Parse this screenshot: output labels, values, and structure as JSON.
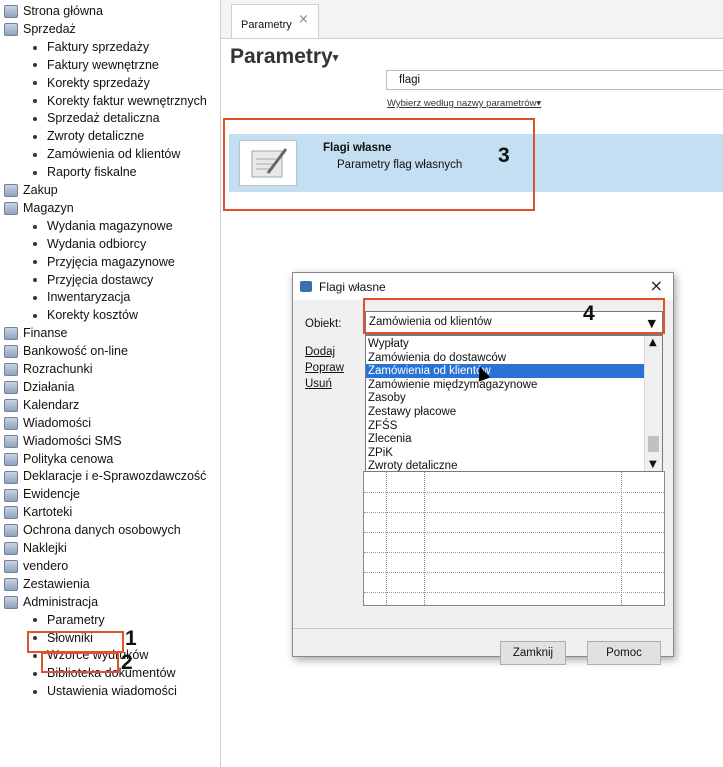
{
  "sidebar": {
    "items": [
      {
        "label": "Strona główna",
        "type": "top"
      },
      {
        "label": "Sprzedaż",
        "type": "top"
      },
      {
        "label": "Faktury sprzedaży",
        "type": "sub"
      },
      {
        "label": "Faktury wewnętrzne",
        "type": "sub"
      },
      {
        "label": "Korekty sprzedaży",
        "type": "sub"
      },
      {
        "label": "Korekty faktur wewnętrznych",
        "type": "sub"
      },
      {
        "label": "Sprzedaż detaliczna",
        "type": "sub"
      },
      {
        "label": "Zwroty detaliczne",
        "type": "sub"
      },
      {
        "label": "Zamówienia od klientów",
        "type": "sub"
      },
      {
        "label": "Raporty fiskalne",
        "type": "sub"
      },
      {
        "label": "Zakup",
        "type": "top"
      },
      {
        "label": "Magazyn",
        "type": "top"
      },
      {
        "label": "Wydania magazynowe",
        "type": "sub"
      },
      {
        "label": "Wydania odbiorcy",
        "type": "sub"
      },
      {
        "label": "Przyjęcia magazynowe",
        "type": "sub"
      },
      {
        "label": "Przyjęcia dostawcy",
        "type": "sub"
      },
      {
        "label": "Inwentaryzacja",
        "type": "sub"
      },
      {
        "label": "Korekty kosztów",
        "type": "sub"
      },
      {
        "label": "Finanse",
        "type": "top"
      },
      {
        "label": "Bankowość on-line",
        "type": "top"
      },
      {
        "label": "Rozrachunki",
        "type": "top"
      },
      {
        "label": "Działania",
        "type": "top"
      },
      {
        "label": "Kalendarz",
        "type": "top"
      },
      {
        "label": "Wiadomości",
        "type": "top"
      },
      {
        "label": "Wiadomości SMS",
        "type": "top"
      },
      {
        "label": "Polityka cenowa",
        "type": "top"
      },
      {
        "label": "Deklaracje i e-Sprawozdawczość",
        "type": "top"
      },
      {
        "label": "Ewidencje",
        "type": "top"
      },
      {
        "label": "Kartoteki",
        "type": "top"
      },
      {
        "label": "Ochrona danych osobowych",
        "type": "top"
      },
      {
        "label": "Naklejki",
        "type": "top"
      },
      {
        "label": "vendero",
        "type": "top"
      },
      {
        "label": "Zestawienia",
        "type": "top"
      },
      {
        "label": "Administracja",
        "type": "top"
      },
      {
        "label": "Parametry",
        "type": "sub"
      },
      {
        "label": "Słowniki",
        "type": "sub"
      },
      {
        "label": "Wzorce wydruków",
        "type": "sub"
      },
      {
        "label": "Biblioteka dokumentów",
        "type": "sub"
      },
      {
        "label": "Ustawienia wiadomości",
        "type": "sub"
      }
    ]
  },
  "tab": {
    "label": "Parametry",
    "close": "×"
  },
  "page": {
    "title": "Parametry",
    "title_arrow": "▾",
    "search_value": "flagi",
    "filter_link": "Wybierz według nazwy parametrów",
    "filter_arrow": "▾"
  },
  "result": {
    "title": "Flagi własne",
    "description": "Parametry flag własnych"
  },
  "annotations": {
    "n1": "1",
    "n2": "2",
    "n3": "3",
    "n4": "4"
  },
  "dialog": {
    "title": "Flagi własne",
    "close": "×",
    "object_label": "Obiekt:",
    "object_value": "Zamówienia od klientów",
    "combo_arrow": "▼",
    "links": [
      "Dodaj",
      "Popraw",
      "Usuń"
    ],
    "options": [
      "Wypłaty",
      "Zamówienia do dostawców",
      "Zamówienia od klientów",
      "Zamówienie międzymagazynowe",
      "Zasoby",
      "Zestawy płacowe",
      "ZFŚS",
      "Zlecenia",
      "ZPiK",
      "Zwroty detaliczne"
    ],
    "selected_option": "Zamówienia od klientów",
    "scroll_up": "▲",
    "scroll_down": "▼",
    "close_button": "Zamknij",
    "help_button": "Pomoc"
  },
  "colors": {
    "annotation": "#e0522a",
    "selection": "#2a72d4",
    "result_bg": "#c4dff2"
  }
}
